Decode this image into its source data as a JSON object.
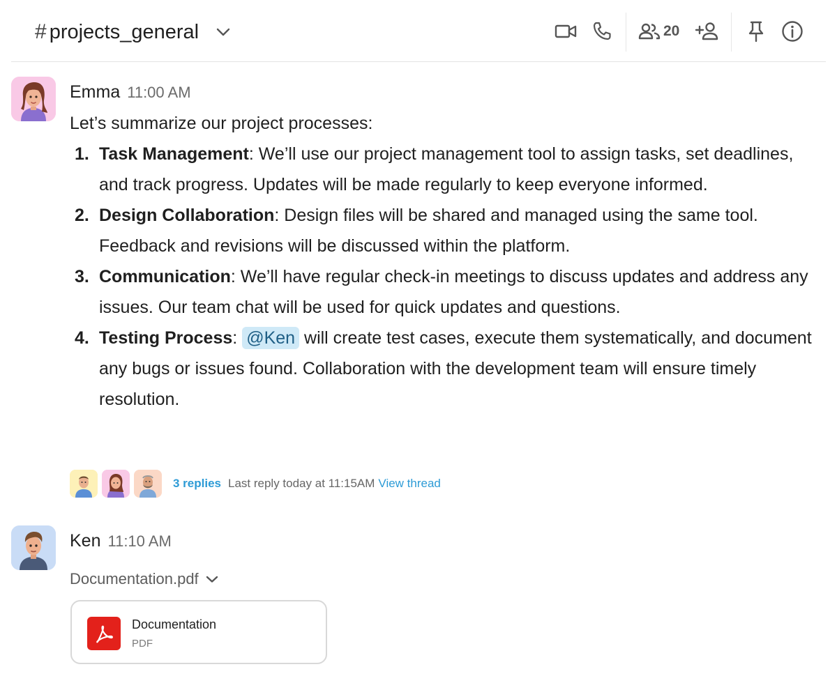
{
  "header": {
    "hash": "#",
    "channel_name": "projects_general",
    "member_count": "20",
    "icons": [
      "video-call-icon",
      "phone-icon",
      "members-icon",
      "add-member-icon",
      "pin-icon",
      "info-icon"
    ]
  },
  "messages": [
    {
      "sender": "Emma",
      "time": "11:00 AM",
      "intro": "Let’s summarize our project processes:",
      "items": [
        {
          "num": "1.",
          "title": "Task Management",
          "text": ": We’ll use our project management tool to assign tasks, set deadlines, and track progress. Updates will be made regularly to keep everyone informed."
        },
        {
          "num": "2.",
          "title": "Design Collaboration",
          "text": ": Design files will be shared and managed using the same tool. Feedback and revisions will be discussed within the platform."
        },
        {
          "num": "3.",
          "title": "Communication",
          "text": ": We’ll have regular check-in meetings to discuss updates and address any issues. Our team chat will be used for quick updates and questions."
        },
        {
          "num": "4.",
          "title": "Testing Process",
          "pre": ": ",
          "mention": "@Ken",
          "text": " will create test cases, execute them systematically, and document any bugs or issues found. Collaboration with the development team will ensure timely resolution."
        }
      ],
      "thread": {
        "replies": "3 replies",
        "last_reply": "Last reply today at 11:15AM",
        "view_thread": "View thread"
      }
    },
    {
      "sender": "Ken",
      "time": "11:10 AM",
      "attachment": {
        "file_name": "Documentation.pdf",
        "title": "Documentation",
        "type": "PDF"
      }
    }
  ],
  "colors": {
    "link": "#2d9bd6",
    "mention_bg": "#cfe9f7",
    "pdf_red": "#e3211b",
    "divider": "#e4e4e4"
  }
}
